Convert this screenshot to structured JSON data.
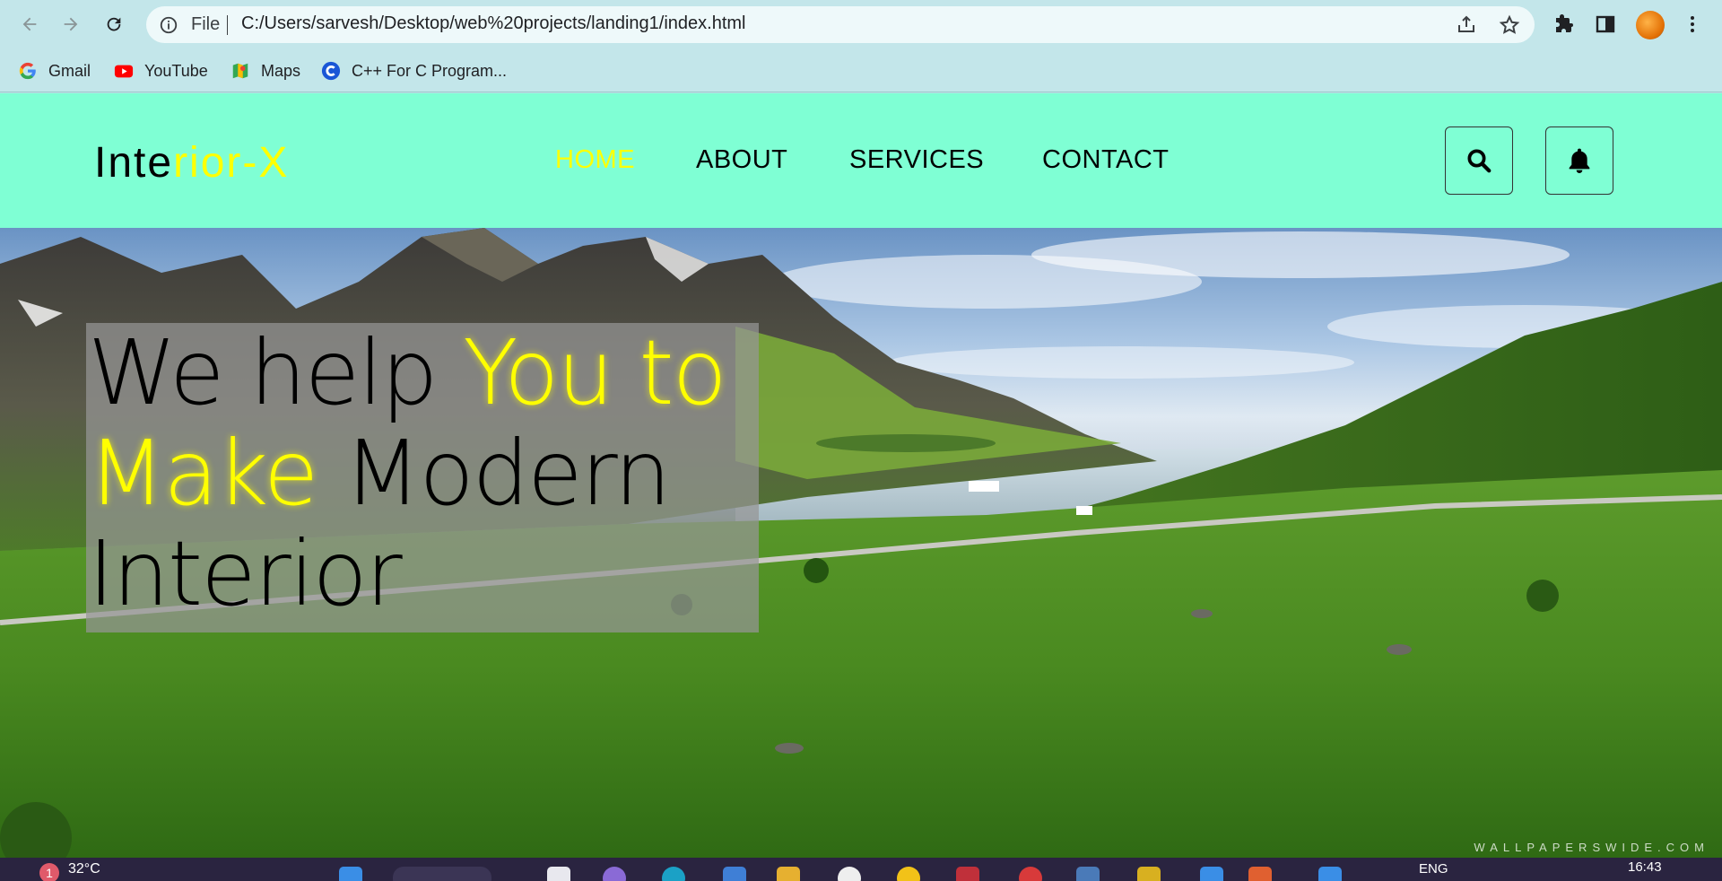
{
  "browser": {
    "omnibox": {
      "scheme_label": "File",
      "url": "C:/Users/sarvesh/Desktop/web%20projects/landing1/index.html"
    },
    "bookmarks": [
      "Gmail",
      "YouTube",
      "Maps",
      "C++ For C Program..."
    ]
  },
  "site": {
    "logo": {
      "part1": "Inte",
      "part2": "rior-X"
    },
    "nav": [
      {
        "label": "HOME",
        "active": true
      },
      {
        "label": "ABOUT",
        "active": false
      },
      {
        "label": "SERVICES",
        "active": false
      },
      {
        "label": "CONTACT",
        "active": false
      }
    ],
    "hero": {
      "w1": "We help ",
      "w2": "You to",
      "w3": "Make",
      "w4": " Modern",
      "w5": "Interior"
    },
    "watermark": "WALLPAPERSWIDE.COM"
  },
  "taskbar": {
    "notification_count": "1",
    "weather": "32°C",
    "language": "ENG",
    "time": "16:43"
  },
  "colors": {
    "header_bg": "#7fffd4",
    "accent_yellow": "#ffff00",
    "chrome_bg": "#c3e6ea"
  }
}
